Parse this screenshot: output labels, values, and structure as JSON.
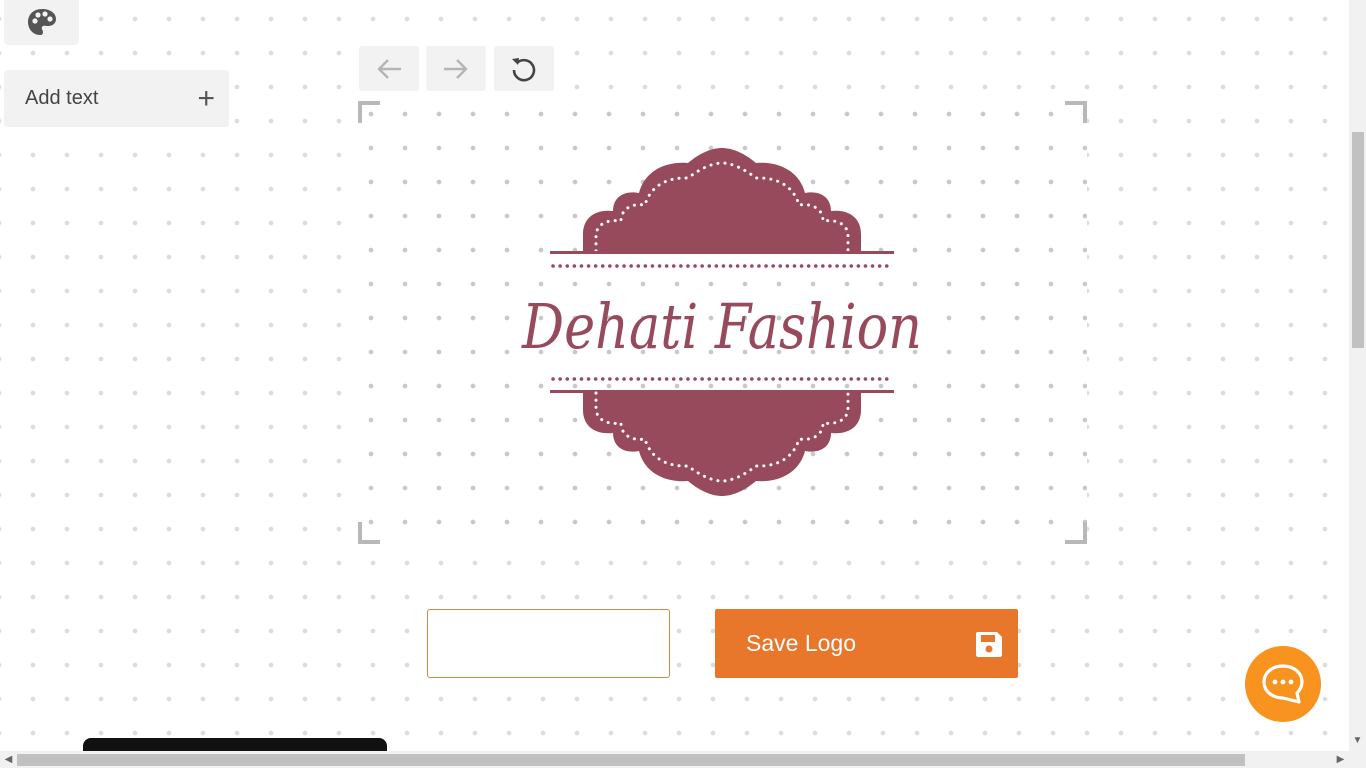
{
  "sidebar": {
    "palette_icon": "palette-icon",
    "add_text_label": "Add text",
    "add_icon": "plus-icon"
  },
  "toolbar": {
    "undo_icon": "arrow-left-icon",
    "redo_icon": "arrow-right-icon",
    "reset_icon": "reset-icon"
  },
  "logo": {
    "text": "Dehati Fashion",
    "color": "#974a5b"
  },
  "actions": {
    "save_label": "Save Logo",
    "save_icon": "floppy-disk-icon",
    "accent_color": "#e8762b"
  },
  "chat": {
    "icon": "chat-bubble-icon",
    "color": "#f7931e"
  }
}
